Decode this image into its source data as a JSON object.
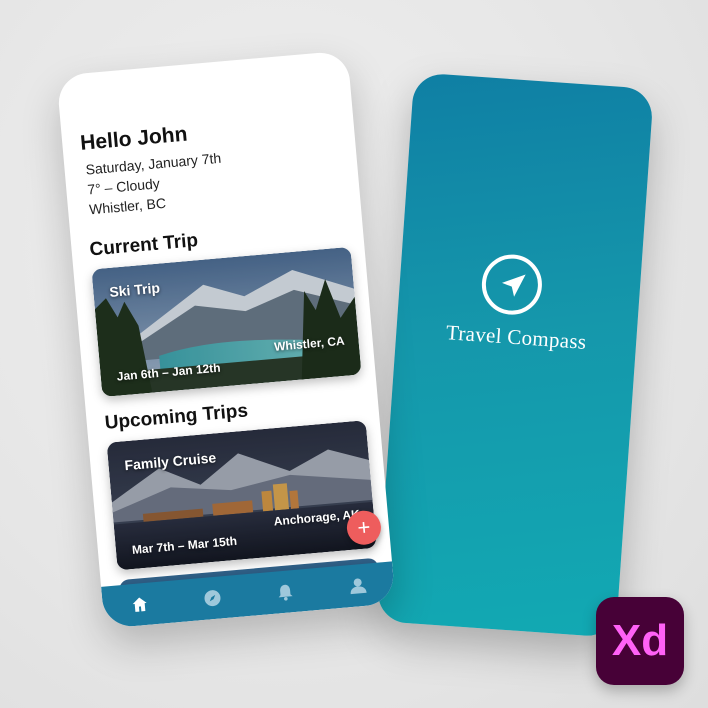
{
  "splash": {
    "brand": "Travel Compass",
    "logo_icon": "compass-arrow-icon"
  },
  "header": {
    "greeting": "Hello John",
    "date": "Saturday, January 7th",
    "weather": "7° – Cloudy",
    "location": "Whistler, BC"
  },
  "sections": {
    "current": "Current Trip",
    "upcoming": "Upcoming Trips"
  },
  "current_trip": {
    "title": "Ski Trip",
    "dates": "Jan 6th – Jan 12th",
    "place": "Whistler, CA"
  },
  "upcoming_trips": [
    {
      "title": "Family Cruise",
      "dates": "Mar 7th – Mar 15th",
      "place": "Anchorage, AK"
    }
  ],
  "fab": {
    "label": "+"
  },
  "nav": {
    "items": [
      "home-icon",
      "compass-icon",
      "bell-icon",
      "profile-icon"
    ],
    "active": "home-icon"
  },
  "badge": {
    "label": "Xd"
  },
  "colors": {
    "accent": "#1b7aa0",
    "fab": "#ee5d5d",
    "splash_top": "#0f7fa4",
    "splash_bottom": "#12a9b3"
  }
}
